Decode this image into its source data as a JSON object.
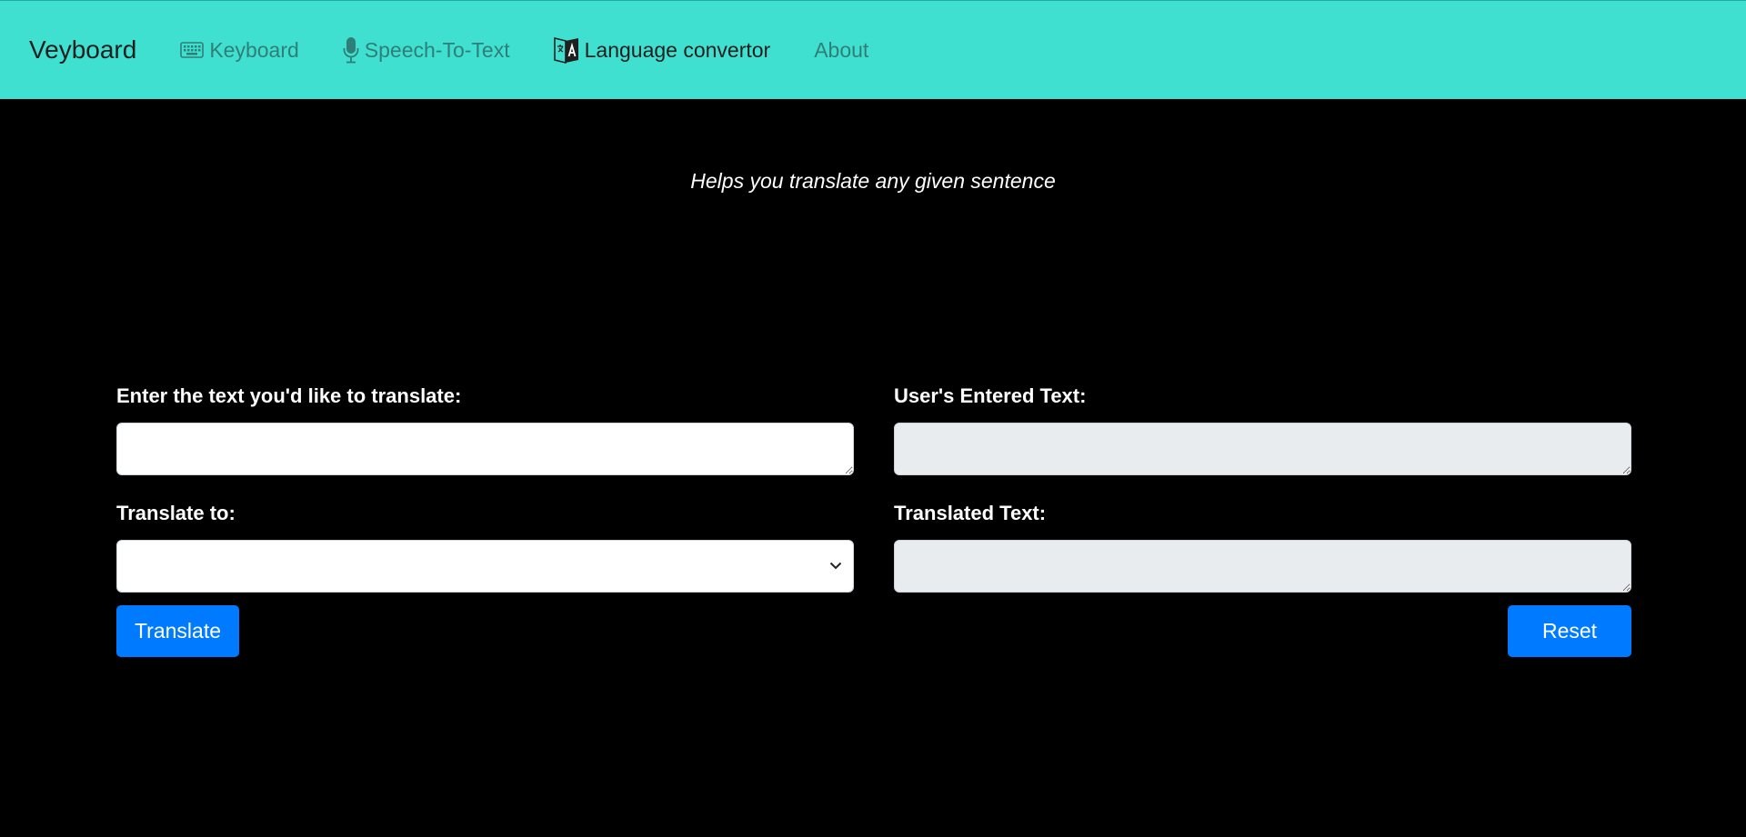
{
  "nav": {
    "brand": "Veyboard",
    "items": [
      {
        "label": "Keyboard",
        "icon": "keyboard-icon",
        "active": false
      },
      {
        "label": "Speech-To-Text",
        "icon": "microphone-icon",
        "active": false
      },
      {
        "label": "Language convertor",
        "icon": "translate-icon",
        "active": true
      },
      {
        "label": "About",
        "icon": "",
        "active": false
      }
    ],
    "colors": {
      "background": "#40e0d0",
      "inactive_text": "#2f7f78",
      "active_text": "#1f1f1f"
    }
  },
  "main": {
    "tagline": "Helps you translate any given sentence",
    "input_label": "Enter the text you'd like to translate:",
    "input_value": "",
    "target_label": "Translate to:",
    "target_selected": "",
    "entered_label": "User's Entered Text:",
    "entered_value": "",
    "translated_label": "Translated Text:",
    "translated_value": "",
    "translate_button": "Translate",
    "reset_button": "Reset",
    "colors": {
      "page_background": "#000000",
      "button": "#007bff",
      "readonly_field": "#e9ecef"
    }
  }
}
